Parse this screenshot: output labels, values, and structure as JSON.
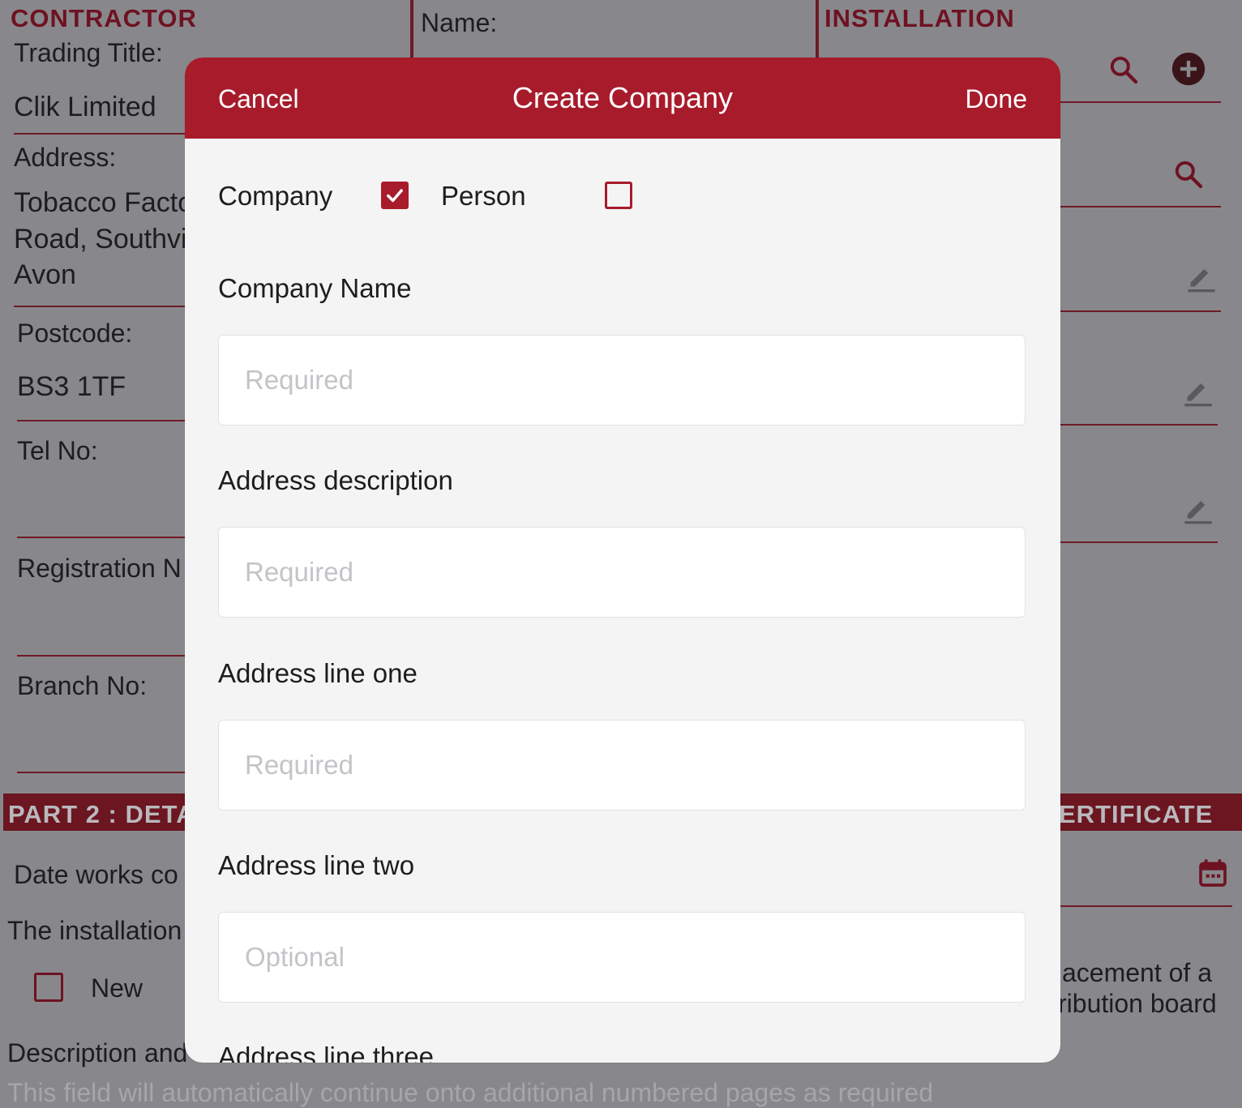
{
  "background": {
    "contractor": {
      "section_title": "CONTRACTOR",
      "trading_title_label": "Trading Title:",
      "trading_title_value": "Clik Limited",
      "address_label": "Address:",
      "address_lines": [
        "Tobacco Facto",
        "Road, Southvi",
        "Avon"
      ],
      "postcode_label": "Postcode:",
      "postcode_value": "BS3 1TF",
      "tel_label": "Tel No:",
      "registration_label": "Registration N",
      "branch_label": "Branch No:"
    },
    "name_label": "Name:",
    "installation_title": "INSTALLATION",
    "part2_banner_left": "PART 2 : DETA",
    "part2_banner_right": "ERTIFICATE",
    "date_works_label": "Date works co",
    "installation_text": "The installation",
    "new_label": "New",
    "replacement_text": [
      "acement of a",
      "ribution board"
    ],
    "description_label": "Description and",
    "bottom_hint": "This field will automatically continue onto additional numbered pages as required"
  },
  "modal": {
    "cancel_label": "Cancel",
    "title": "Create Company",
    "done_label": "Done",
    "type_company_label": "Company",
    "type_company_checked": true,
    "type_person_label": "Person",
    "type_person_checked": false,
    "fields": [
      {
        "label": "Company Name",
        "placeholder": "Required",
        "value": ""
      },
      {
        "label": "Address description",
        "placeholder": "Required",
        "value": ""
      },
      {
        "label": "Address line one",
        "placeholder": "Required",
        "value": ""
      },
      {
        "label": "Address line two",
        "placeholder": "Optional",
        "value": ""
      },
      {
        "label": "Address line three"
      }
    ]
  },
  "colors": {
    "accent": "#a71b2b",
    "dim_accent": "#6e1222",
    "modal_bg": "#f4f4f4",
    "overlay_bg": "#88888c"
  }
}
